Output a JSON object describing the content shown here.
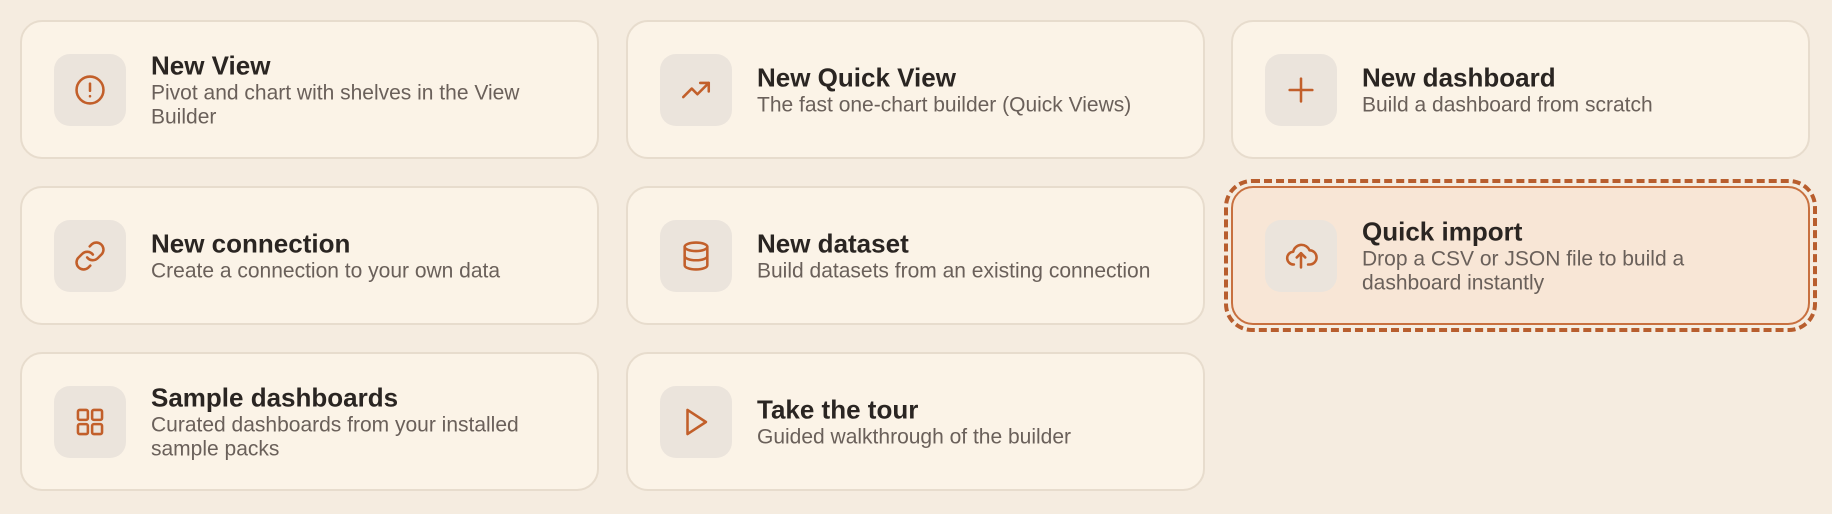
{
  "cards": [
    {
      "title": "New View",
      "desc": "Pivot and chart with shelves in the View Builder",
      "icon": "alert-circle-icon"
    },
    {
      "title": "New Quick View",
      "desc": "The fast one-chart builder (Quick Views)",
      "icon": "trending-up-icon"
    },
    {
      "title": "New dashboard",
      "desc": "Build a dashboard from scratch",
      "icon": "plus-icon"
    },
    {
      "title": "New connection",
      "desc": "Create a connection to your own data",
      "icon": "link-icon"
    },
    {
      "title": "New dataset",
      "desc": "Build datasets from an existing connection",
      "icon": "database-icon"
    },
    {
      "title": "Quick import",
      "desc": "Drop a CSV or JSON file to build a dashboard instantly",
      "icon": "cloud-upload-icon",
      "highlighted": true
    },
    {
      "title": "Sample dashboards",
      "desc": "Curated dashboards from your installed sample packs",
      "icon": "grid-icon"
    },
    {
      "title": "Take the tour",
      "desc": "Guided walkthrough of the builder",
      "icon": "play-icon"
    }
  ],
  "colors": {
    "background": "#f5ece0",
    "card": "#fbf3e7",
    "accent": "#c25f2a",
    "highlight_bg": "#f8e6d6"
  }
}
